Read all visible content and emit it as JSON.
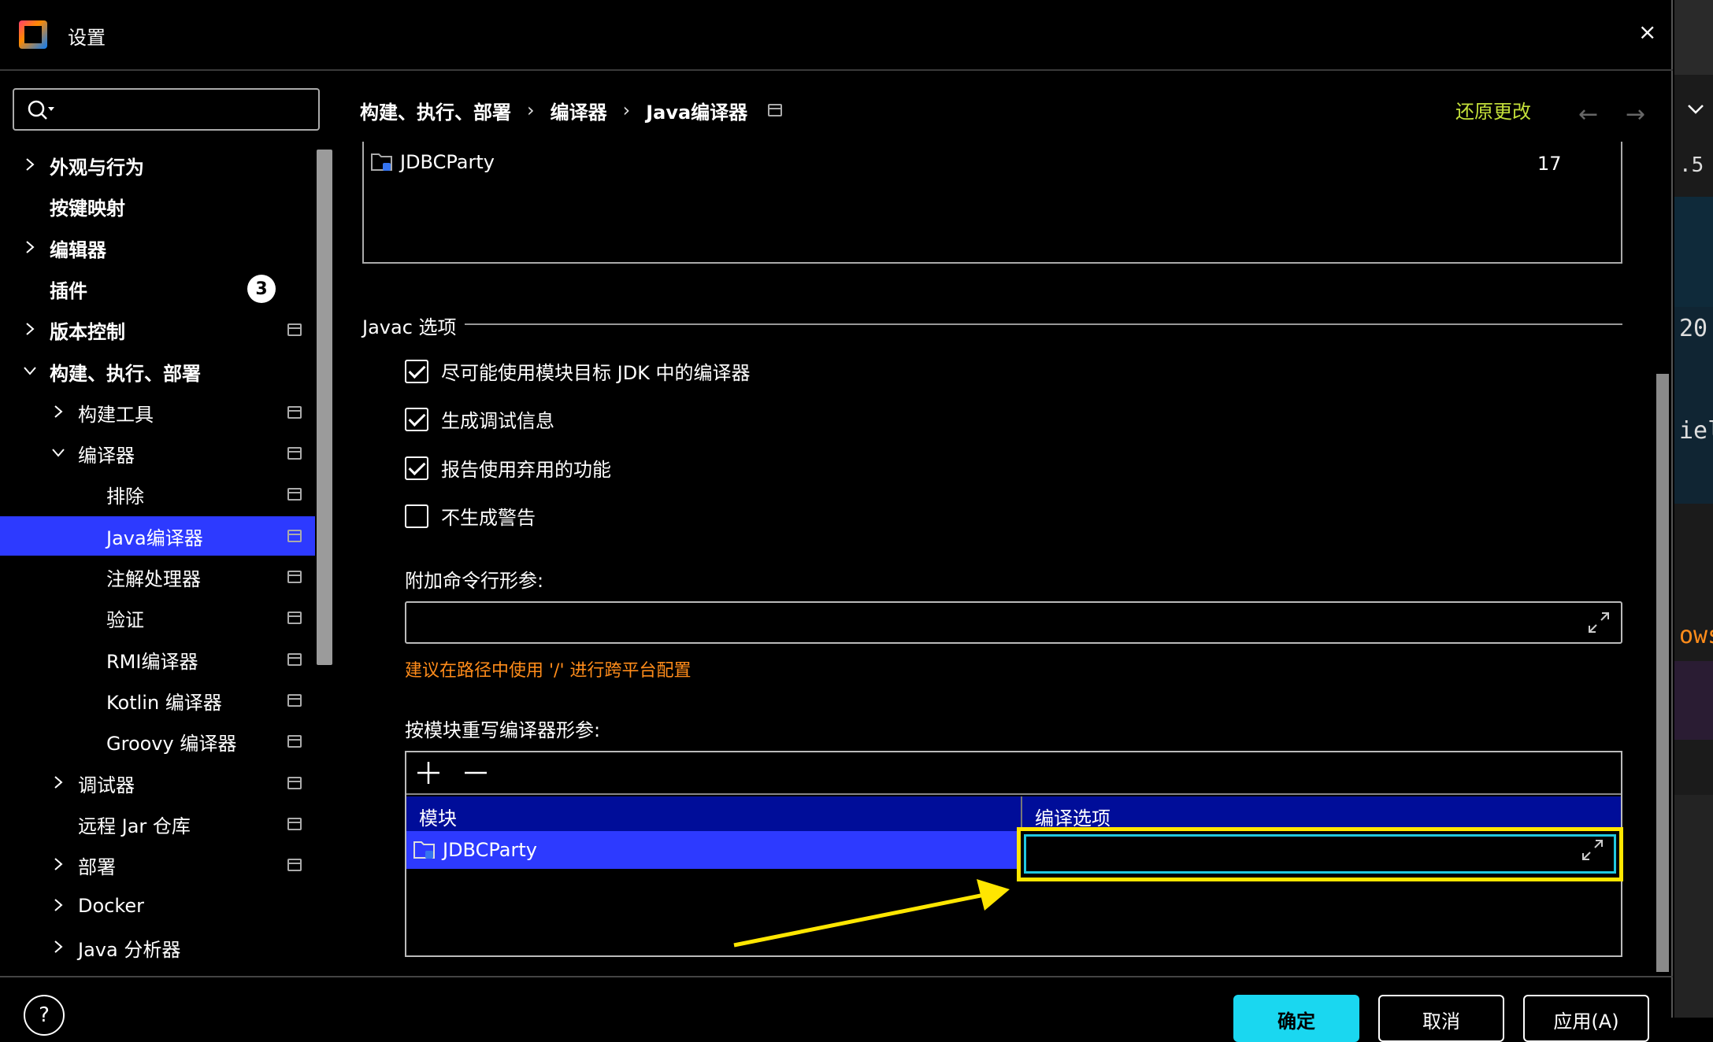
{
  "window": {
    "title": "设置",
    "close_icon": "×"
  },
  "search": {
    "placeholder": "",
    "value": ""
  },
  "sidebar": {
    "items": [
      {
        "label": "外观与行为",
        "expand": "collapsed",
        "bold": true
      },
      {
        "label": "按键映射",
        "expand": "none",
        "bold": true
      },
      {
        "label": "编辑器",
        "expand": "collapsed",
        "bold": true
      },
      {
        "label": "插件",
        "expand": "none",
        "bold": true,
        "badge": "3"
      },
      {
        "label": "版本控制",
        "expand": "collapsed",
        "bold": true
      },
      {
        "label": "构建、执行、部署",
        "expand": "expanded",
        "bold": true
      },
      {
        "label": "构建工具",
        "expand": "collapsed"
      },
      {
        "label": "编译器",
        "expand": "expanded"
      },
      {
        "label": "排除",
        "expand": "none"
      },
      {
        "label": "Java编译器",
        "expand": "none",
        "selected": true
      },
      {
        "label": "注解处理器",
        "expand": "none"
      },
      {
        "label": "验证",
        "expand": "none"
      },
      {
        "label": "RMI编译器",
        "expand": "none"
      },
      {
        "label": "Kotlin 编译器",
        "expand": "none"
      },
      {
        "label": "Groovy 编译器",
        "expand": "none"
      },
      {
        "label": "调试器",
        "expand": "collapsed"
      },
      {
        "label": "远程 Jar 仓库",
        "expand": "none"
      },
      {
        "label": "部署",
        "expand": "collapsed"
      },
      {
        "label": "Docker",
        "expand": "collapsed"
      },
      {
        "label": "Java 分析器",
        "expand": "collapsed"
      }
    ]
  },
  "header": {
    "breadcrumb": [
      "构建、执行、部署",
      "编译器",
      "Java编译器"
    ],
    "breadcrumb_sep": "›",
    "reset_label": "还原更改",
    "back_icon": "←",
    "forward_icon": "→"
  },
  "modules_table": {
    "rows": [
      {
        "name": "JDBCParty",
        "level": "17"
      }
    ]
  },
  "javac": {
    "section_title": "Javac 选项",
    "options": [
      {
        "label": "尽可能使用模块目标 JDK 中的编译器",
        "checked": true
      },
      {
        "label": "生成调试信息",
        "checked": true
      },
      {
        "label": "报告使用弃用的功能",
        "checked": true
      },
      {
        "label": "不生成警告",
        "checked": false
      }
    ],
    "extra_args_label": "附加命令行形参:",
    "extra_args_value": "",
    "hint": "建议在路径中使用 '/' 进行跨平台配置",
    "override_label": "按模块重写编译器形参:",
    "override_table": {
      "columns": [
        "模块",
        "编译选项"
      ],
      "rows": [
        {
          "module": "JDBCParty",
          "options": ""
        }
      ]
    }
  },
  "footer": {
    "help_label": "?",
    "ok_label": "确定",
    "cancel_label": "取消",
    "apply_label": "应用(A)"
  },
  "background_editor": {
    "snippets": [
      ".5",
      "20",
      "iel",
      "ows"
    ]
  },
  "colors": {
    "accent_selection": "#2d3aff",
    "table_header": "#000d99",
    "reset_link": "#c4e03a",
    "hint": "#ff8c1a",
    "annotation_box": "#ffe600",
    "focus_ring": "#20c8e0",
    "primary_button": "#1ad7f0"
  }
}
